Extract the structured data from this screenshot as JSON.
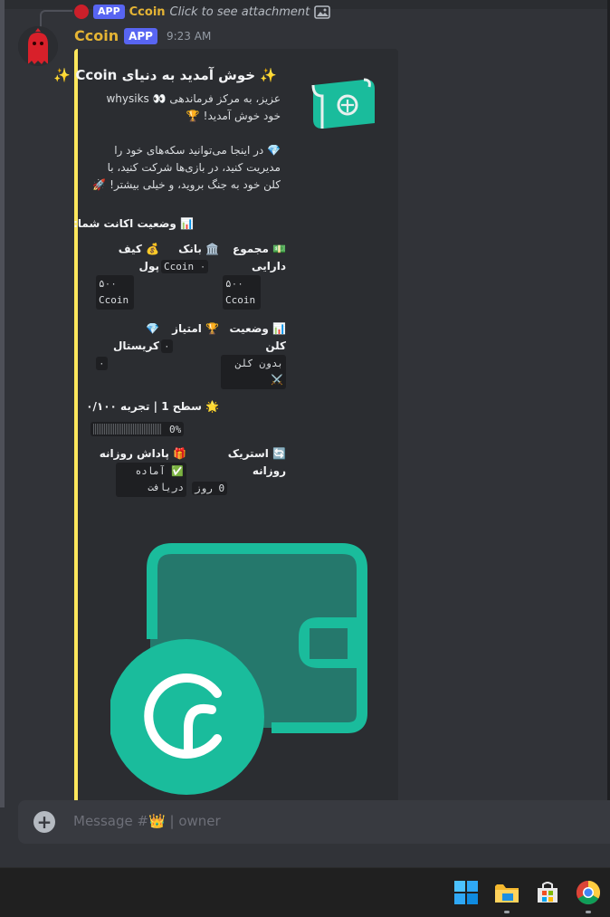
{
  "reply": {
    "badge": "APP",
    "name": "Ccoin",
    "text": "Click to see attachment",
    "image_icon": "image-icon"
  },
  "message": {
    "author": "Ccoin",
    "badge": "APP",
    "time": "9:23 AM",
    "avatar_icon": "red-ghost-avatar"
  },
  "embed": {
    "accent_color": "#fee75c",
    "title": "✨ خوش آمدید به دنیای Ccoin ✨",
    "greeting_line1": "عزیز، به مرکز فرماندهی 👀 whysiks",
    "greeting_line2": "خود خوش آمدید! 🏆",
    "intro": "💎 در اینجا می‌توانید سکه‌های خود را مدیریت کنید، در بازی‌ها شرکت کنید، با کلن خود به جنگ بروید، و خیلی بیشتر! 🚀",
    "account_status": "📊 وضعیت اکانت شما:",
    "fields": {
      "wallet": {
        "name": "💰 کیف پول",
        "value": "۵۰۰ Ccoin"
      },
      "bank": {
        "name": "🏛️ بانک",
        "value": "۰ Ccoin"
      },
      "total": {
        "name": "💵 مجموع دارایی",
        "value": "۵۰۰ Ccoin"
      },
      "crystal": {
        "name": "💎 کریستال",
        "value": "۰"
      },
      "score": {
        "name": "🏆 امتیاز",
        "value": "۰"
      },
      "clan": {
        "name": "📊 وضعیت کلن",
        "value": "بدون کلن ⚔️"
      },
      "daily_reward": {
        "name": "🎁 پاداش روزانه",
        "value": "✅ آماده دریافت"
      },
      "streak": {
        "name": "🔄 استریک روزانه",
        "value": "0 روز"
      }
    },
    "level_line": "🌟 سطح 1 | تجربه ۰/۱۰۰",
    "progress": {
      "percent_label": "0%",
      "fraction": 0
    },
    "thumbnail_icon": "money-bill-icon",
    "image_icon": "ccoin-wallet-logo",
    "brand_color": "#1abc9c"
  },
  "composer": {
    "placeholder": "Message #👑 | owner",
    "plus_icon": "plus-circle-icon"
  },
  "taskbar": {
    "items": [
      "windows-start-icon",
      "file-explorer-icon",
      "microsoft-store-icon",
      "chrome-icon"
    ]
  }
}
